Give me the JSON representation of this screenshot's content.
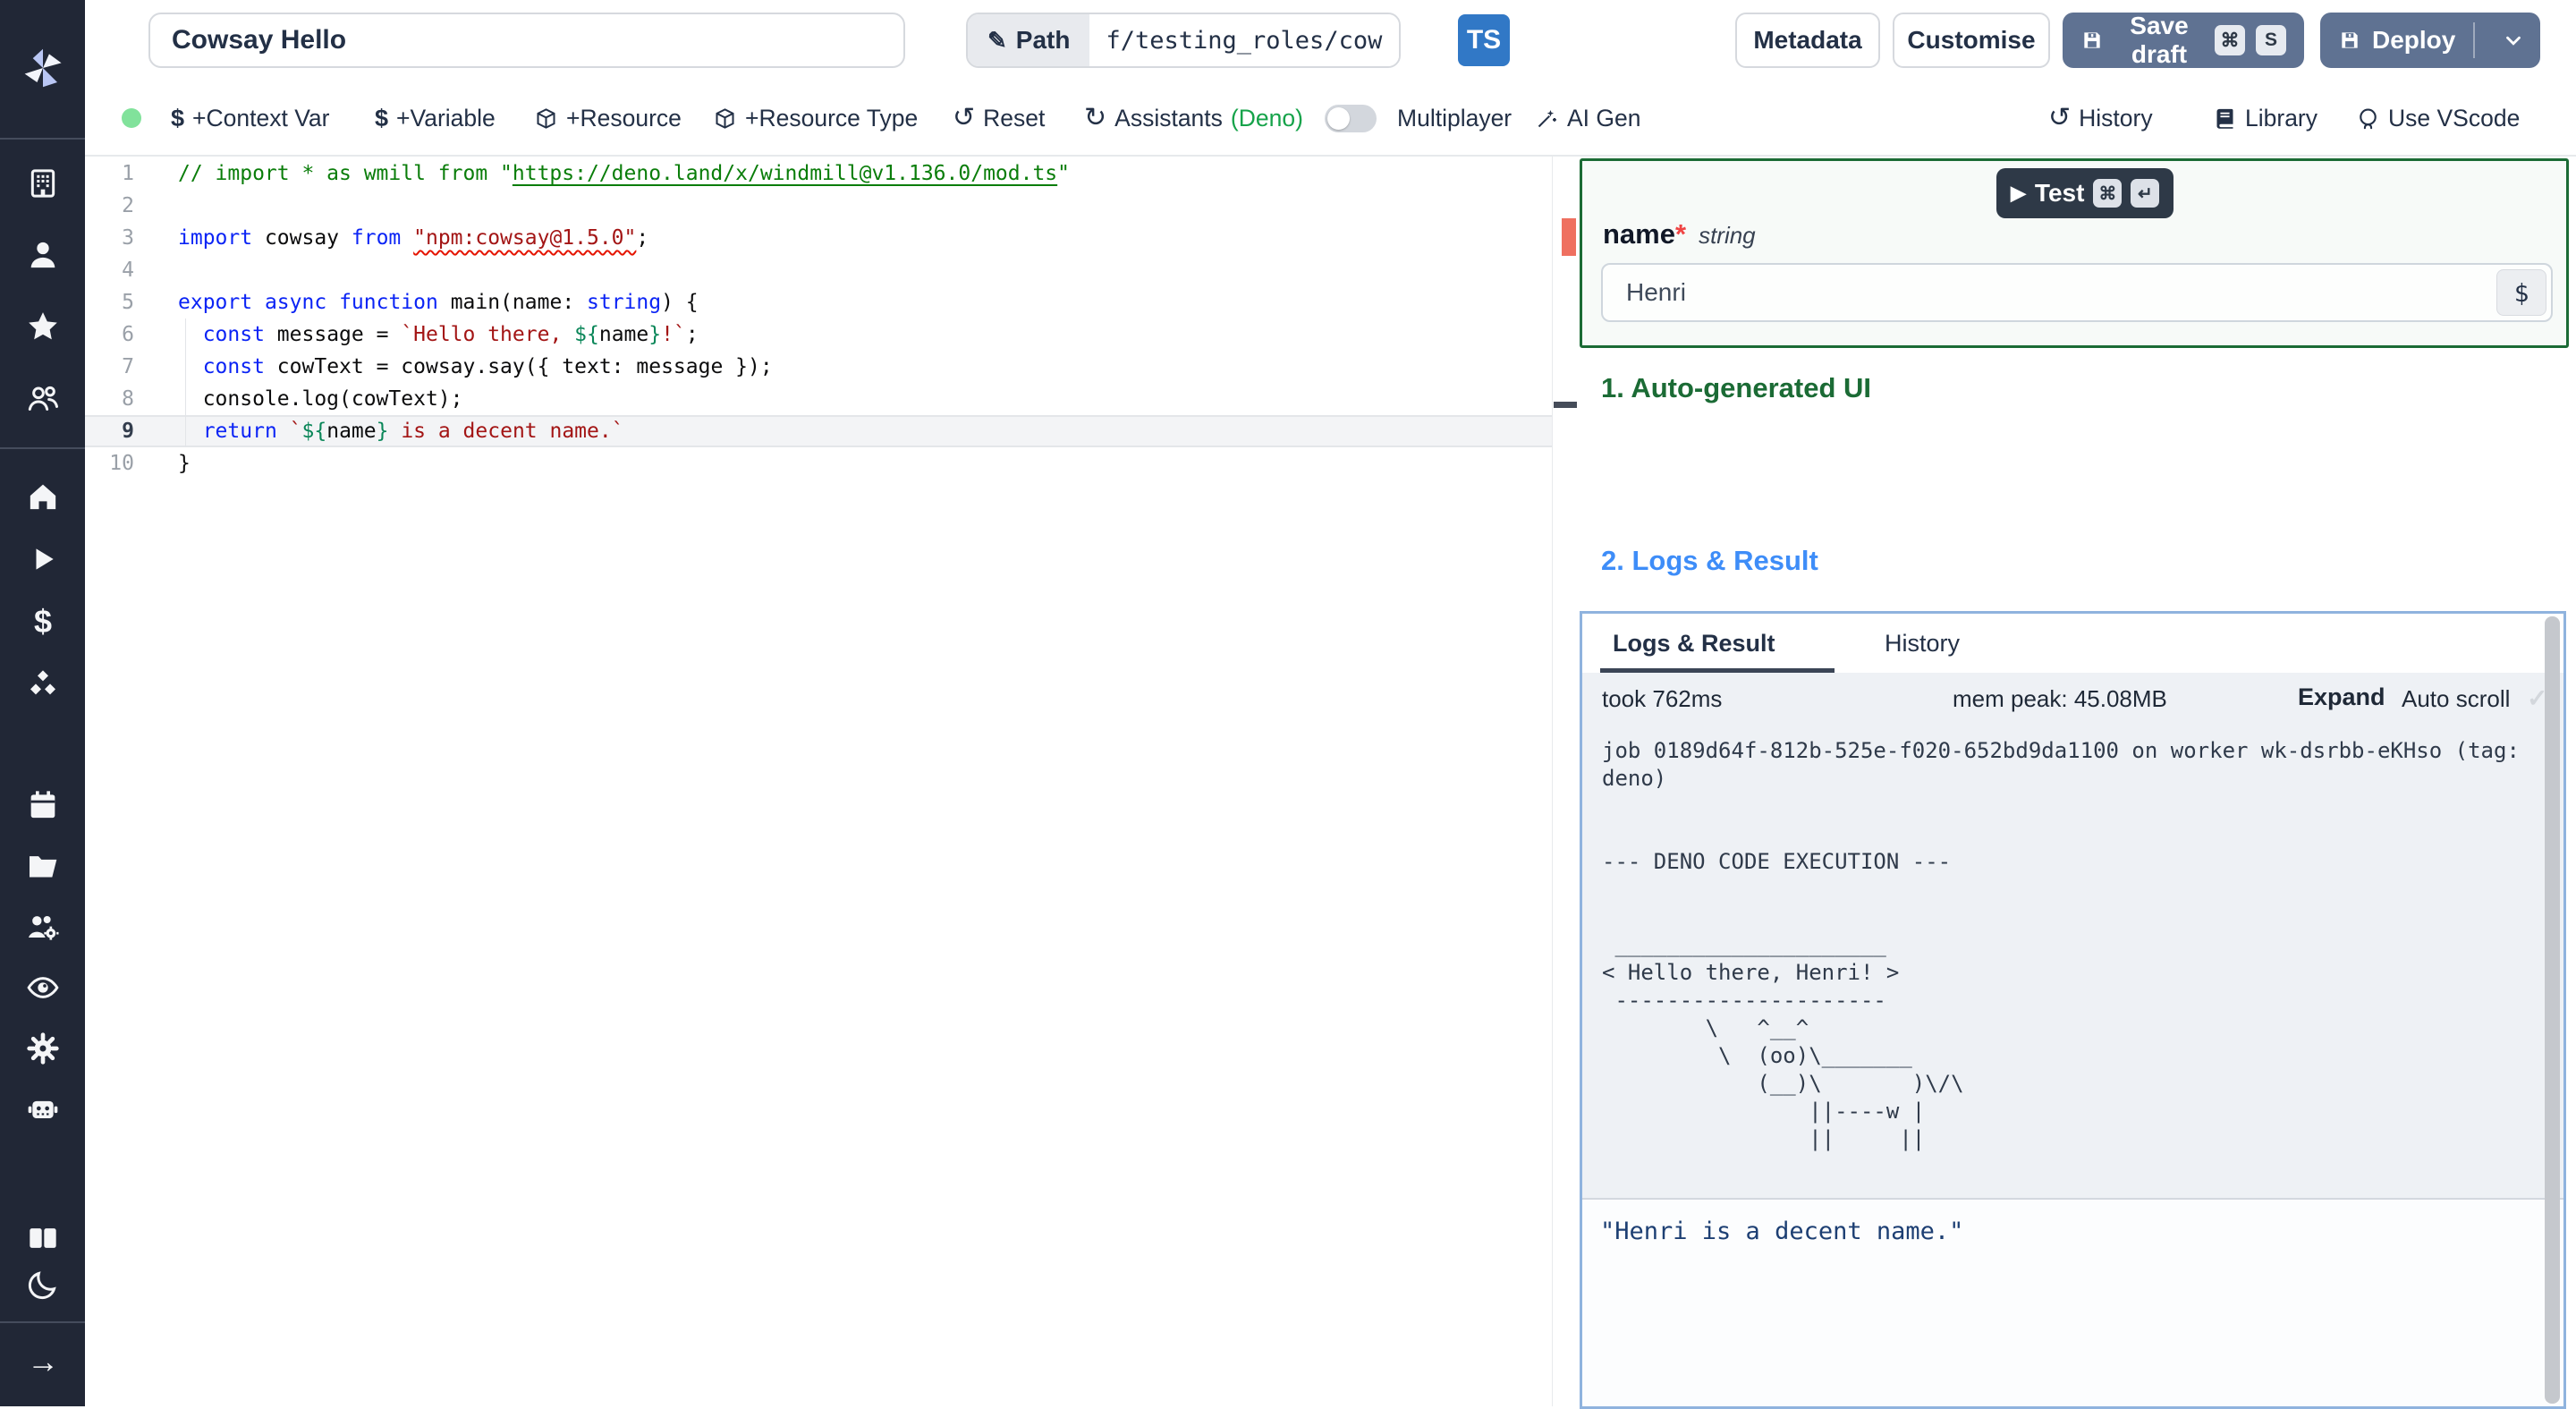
{
  "app": {
    "accent_green": "#1b6b35",
    "accent_blue": "#3e8df8",
    "ts_blue": "#3178c6",
    "button_slate": "#5f7292",
    "deno_green": "#16a34a",
    "status_dot_green": "#81e29b"
  },
  "topbar": {
    "title": "Cowsay Hello",
    "path_label": "Path",
    "path_value": "f/testing_roles/cowsa",
    "lang_badge": "TS",
    "metadata_label": "Metadata",
    "customise_label": "Customise",
    "save_draft_label": "Save draft",
    "save_keys": [
      "⌘",
      "S"
    ],
    "deploy_label": "Deploy"
  },
  "toolbar": {
    "context_var": "+Context Var",
    "variable": "+Variable",
    "resource": "+Resource",
    "resource_type": "+Resource Type",
    "reset": "Reset",
    "assistants": "Assistants",
    "assistants_lang": "(Deno)",
    "multiplayer": "Multiplayer",
    "ai_gen": "AI Gen",
    "history": "History",
    "library": "Library",
    "use_vscode": "Use VScode"
  },
  "sidebar": {
    "icons": [
      "windmill-logo",
      "workspace-building",
      "user",
      "favorites-star",
      "groups",
      "home",
      "runs-play",
      "variables-dollar",
      "resources-cubes",
      "schedules-calendar",
      "folders",
      "groups-settings",
      "audit-eye",
      "settings-gear",
      "workers-robot",
      "docs-books",
      "dark-mode-moon",
      "expand-arrow"
    ]
  },
  "editor": {
    "current_line": 9,
    "lines": [
      {
        "n": 1,
        "segs": [
          [
            "// import * as wmill from \"",
            "c"
          ],
          [
            "https://deno.land/x/windmill@v1.136.0/mod.ts",
            "cl"
          ],
          [
            "\"",
            "c"
          ]
        ]
      },
      {
        "n": 2,
        "segs": []
      },
      {
        "n": 3,
        "segs": [
          [
            "import",
            "k"
          ],
          [
            " cowsay ",
            "p"
          ],
          [
            "from",
            "k"
          ],
          [
            " ",
            "p"
          ],
          [
            "\"npm:cowsay@1.5.0\"",
            "se"
          ],
          [
            ";",
            "p"
          ]
        ]
      },
      {
        "n": 4,
        "segs": []
      },
      {
        "n": 5,
        "segs": [
          [
            "export",
            "k"
          ],
          [
            " ",
            "p"
          ],
          [
            "async",
            "k"
          ],
          [
            " ",
            "p"
          ],
          [
            "function",
            "k"
          ],
          [
            " main(name: ",
            "p"
          ],
          [
            "string",
            "k"
          ],
          [
            ") {",
            "p"
          ]
        ]
      },
      {
        "n": 6,
        "segs": [
          [
            "  ",
            "p"
          ],
          [
            "const",
            "k"
          ],
          [
            " message = ",
            "p"
          ],
          [
            "`Hello there, ",
            "s"
          ],
          [
            "${",
            "x"
          ],
          [
            "name",
            "p"
          ],
          [
            "}",
            "x"
          ],
          [
            "!`",
            "s"
          ],
          [
            ";",
            "p"
          ]
        ]
      },
      {
        "n": 7,
        "segs": [
          [
            "  ",
            "p"
          ],
          [
            "const",
            "k"
          ],
          [
            " cowText = cowsay.say({ text: message });",
            "p"
          ]
        ]
      },
      {
        "n": 8,
        "segs": [
          [
            "  console.log(cowText);",
            "p"
          ]
        ]
      },
      {
        "n": 9,
        "segs": [
          [
            "  ",
            "p"
          ],
          [
            "return",
            "k"
          ],
          [
            " ",
            "p"
          ],
          [
            "`",
            "s"
          ],
          [
            "${",
            "x"
          ],
          [
            "name",
            "p"
          ],
          [
            "}",
            "x"
          ],
          [
            " is a decent name.`",
            "s"
          ]
        ]
      },
      {
        "n": 10,
        "segs": [
          [
            "}",
            "p"
          ]
        ]
      }
    ]
  },
  "run_panel": {
    "test_label": "Test",
    "test_keys": [
      "⌘",
      "↵"
    ],
    "arg_name": "name",
    "required_mark": "*",
    "arg_type": "string",
    "arg_value": "Henri",
    "insert_var": "$",
    "section_ui": "1. Auto-generated UI",
    "section_logs": "2. Logs & Result"
  },
  "logs": {
    "tabs": [
      "Logs & Result",
      "History"
    ],
    "took": "took 762ms",
    "mem": "mem peak: 45.08MB",
    "expand": "Expand",
    "autoscroll": "Auto scroll",
    "check_glyph": "✓",
    "lines": [
      "job 0189d64f-812b-525e-f020-652bd9da1100 on worker wk-dsrbb-eKHso (tag:",
      "deno)",
      "",
      "",
      "--- DENO CODE EXECUTION ---",
      "",
      "",
      " _____________________",
      "< Hello there, Henri! >",
      " ---------------------",
      "        \\   ^__^",
      "         \\  (oo)\\_______",
      "            (__)\\       )\\/\\",
      "                ||----w |",
      "                ||     ||"
    ],
    "result": "\"Henri is a decent name.\""
  }
}
